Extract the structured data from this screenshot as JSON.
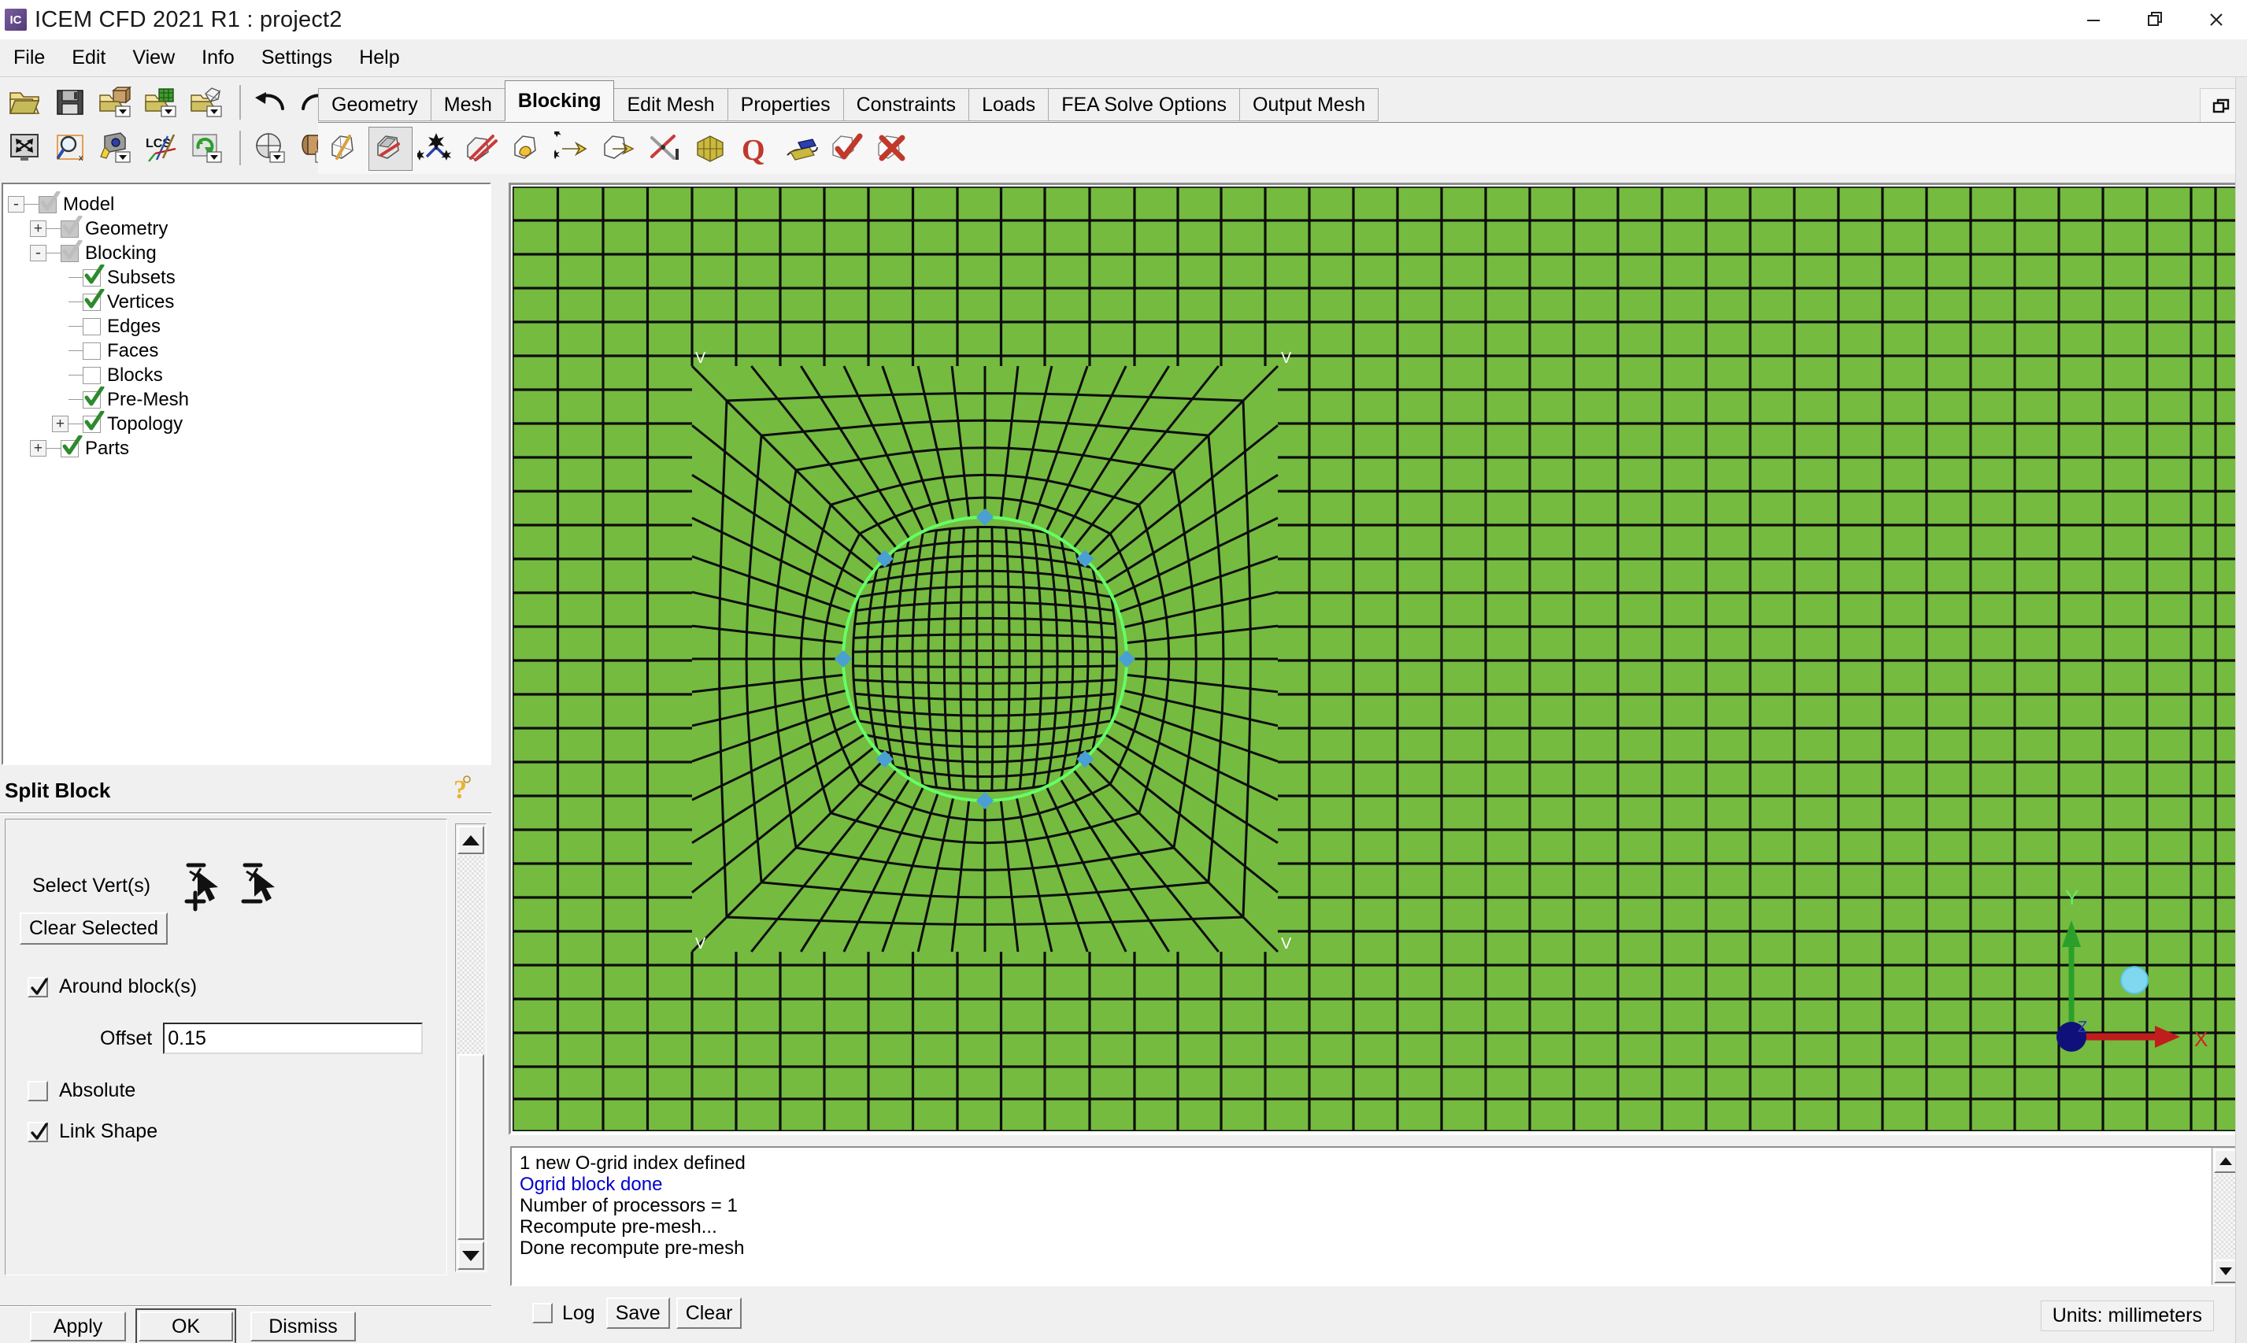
{
  "window": {
    "title": "ICEM CFD 2021 R1 : project2",
    "app_icon": "IC",
    "minimize": "minimize-icon",
    "restore": "restore-icon",
    "close": "close-icon"
  },
  "menubar": {
    "items": [
      "File",
      "Edit",
      "View",
      "Info",
      "Settings",
      "Help"
    ]
  },
  "toolbar": {
    "row1": [
      {
        "name": "open-project-icon",
        "title": "Open Project"
      },
      {
        "name": "save-project-icon",
        "title": "Save Project"
      },
      {
        "name": "open-geometry-icon",
        "title": "Open Geometry"
      },
      {
        "name": "open-mesh-icon",
        "title": "Open Mesh"
      },
      {
        "name": "open-blocking-icon",
        "title": "Open Blocking"
      },
      {
        "name": "undo-icon",
        "title": "Undo"
      },
      {
        "name": "redo-icon",
        "title": "Redo"
      }
    ],
    "row2": [
      {
        "name": "fit-window-icon",
        "title": "Fit Window"
      },
      {
        "name": "zoom-box-icon",
        "title": "Zoom Box"
      },
      {
        "name": "measure-icon",
        "title": "Measure"
      },
      {
        "name": "lcs-icon",
        "title": "Local Coordinate System"
      },
      {
        "name": "refresh-icon",
        "title": "Refresh"
      },
      {
        "name": "clip-plane-icon",
        "title": "Clip Plane"
      },
      {
        "name": "solid-view-icon",
        "title": "Solid View"
      }
    ]
  },
  "tabs": [
    {
      "label": "Geometry",
      "active": false
    },
    {
      "label": "Mesh",
      "active": false
    },
    {
      "label": "Blocking",
      "active": true
    },
    {
      "label": "Edit Mesh",
      "active": false
    },
    {
      "label": "Properties",
      "active": false
    },
    {
      "label": "Constraints",
      "active": false
    },
    {
      "label": "Loads",
      "active": false
    },
    {
      "label": "FEA Solve Options",
      "active": false
    },
    {
      "label": "Output Mesh",
      "active": false
    }
  ],
  "blocking_tools": [
    {
      "name": "create-block-icon",
      "pressed": false
    },
    {
      "name": "split-block-icon",
      "pressed": true
    },
    {
      "name": "merge-vertices-icon",
      "pressed": false
    },
    {
      "name": "edit-block-icon",
      "pressed": false
    },
    {
      "name": "associate-icon",
      "pressed": false
    },
    {
      "name": "move-vertex-icon",
      "pressed": false
    },
    {
      "name": "transform-block-icon",
      "pressed": false
    },
    {
      "name": "edit-edge-icon",
      "pressed": false
    },
    {
      "name": "pre-mesh-params-icon",
      "pressed": false
    },
    {
      "name": "pre-mesh-quality-icon",
      "pressed": false
    },
    {
      "name": "scan-planes-icon",
      "pressed": false
    },
    {
      "name": "check-blocks-icon",
      "pressed": false
    },
    {
      "name": "delete-block-icon",
      "pressed": false
    }
  ],
  "tree": {
    "nodes": [
      {
        "label": "Model",
        "depth": 0,
        "expander": "-",
        "check": "gray",
        "checked": true
      },
      {
        "label": "Geometry",
        "depth": 1,
        "expander": "+",
        "check": "gray",
        "checked": true
      },
      {
        "label": "Blocking",
        "depth": 1,
        "expander": "-",
        "check": "gray",
        "checked": true
      },
      {
        "label": "Subsets",
        "depth": 2,
        "expander": "",
        "check": "green",
        "checked": true
      },
      {
        "label": "Vertices",
        "depth": 2,
        "expander": "",
        "check": "green",
        "checked": true
      },
      {
        "label": "Edges",
        "depth": 2,
        "expander": "",
        "check": "empty",
        "checked": false
      },
      {
        "label": "Faces",
        "depth": 2,
        "expander": "",
        "check": "empty",
        "checked": false
      },
      {
        "label": "Blocks",
        "depth": 2,
        "expander": "",
        "check": "empty",
        "checked": false
      },
      {
        "label": "Pre-Mesh",
        "depth": 2,
        "expander": "",
        "check": "green",
        "checked": true
      },
      {
        "label": "Topology",
        "depth": 2,
        "expander": "+",
        "check": "green",
        "checked": true
      },
      {
        "label": "Parts",
        "depth": 1,
        "expander": "+",
        "check": "green",
        "checked": true
      }
    ]
  },
  "split_block": {
    "title": "Split Block",
    "help_icon": "help-question-icon",
    "select_verts_label": "Select Vert(s)",
    "select_add_icon": "cursor-add-icon",
    "select_remove_icon": "cursor-remove-icon",
    "clear_selected_label": "Clear Selected",
    "around_blocks_label": "Around block(s)",
    "around_blocks_checked": true,
    "offset_label": "Offset",
    "offset_value": "0.15",
    "absolute_label": "Absolute",
    "absolute_checked": false,
    "link_shape_label": "Link Shape",
    "link_shape_checked": true
  },
  "actions": {
    "apply": "Apply",
    "ok": "OK",
    "dismiss": "Dismiss"
  },
  "log": {
    "lines": [
      {
        "text": "1 new O-grid index defined",
        "color": "black"
      },
      {
        "text": "Ogrid block done",
        "color": "blue"
      },
      {
        "text": "Number of processors = 1",
        "color": "black"
      },
      {
        "text": "Recompute pre-mesh...",
        "color": "black"
      },
      {
        "text": "Done recompute pre-mesh",
        "color": "black"
      }
    ],
    "log_checkbox_label": "Log",
    "log_checked": false,
    "save_label": "Save",
    "clear_label": "Clear"
  },
  "statusbar": {
    "units": "Units: millimeters"
  },
  "viewport": {
    "mesh_fill": "#74bb40",
    "mesh_line": "#0d0d0d",
    "ogrid_circle_color": "#66ff66",
    "vertex_color": "#4a9fd4",
    "axis_x_color": "#c01d1d",
    "axis_y_color": "#2aa02a",
    "axis_origin_color": "#10107a",
    "marker_color": "#7fd8f0",
    "axis_x_label": "X",
    "axis_y_label": "Y",
    "vertex_label": "V"
  }
}
